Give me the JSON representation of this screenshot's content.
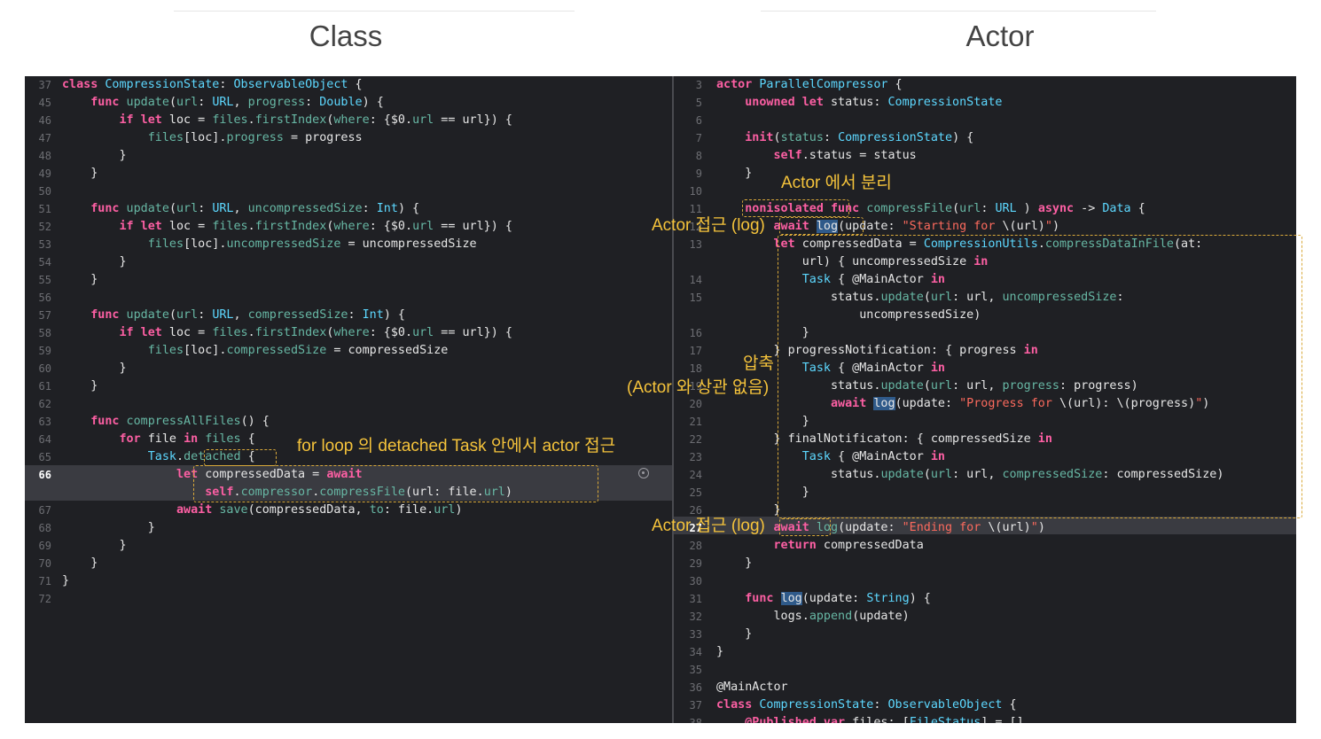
{
  "headings": {
    "left": "Class",
    "right": "Actor"
  },
  "left_lines": [
    {
      "n": "37",
      "t": [
        [
          "k",
          "class"
        ],
        [
          "",
          ""
        ],
        [
          "t",
          " CompressionState"
        ],
        [
          "",
          ": "
        ],
        [
          "t",
          "ObservableObject"
        ],
        [
          "",
          ""
        ],
        [
          "",
          " {"
        ]
      ]
    },
    {
      "n": "45",
      "t": [
        [
          "",
          "    "
        ],
        [
          "k",
          "func"
        ],
        [
          "f",
          " update"
        ],
        [
          "",
          "("
        ],
        [
          "f",
          "url"
        ],
        [
          "",
          ": "
        ],
        [
          "t",
          "URL"
        ],
        [
          "",
          ", "
        ],
        [
          "f",
          "progress"
        ],
        [
          "",
          ": "
        ],
        [
          "t",
          "Double"
        ],
        [
          "",
          ") {"
        ]
      ]
    },
    {
      "n": "46",
      "t": [
        [
          "",
          "        "
        ],
        [
          "k",
          "if let"
        ],
        [
          "",
          " loc = "
        ],
        [
          "f",
          "files"
        ],
        [
          "",
          "."
        ],
        [
          "f",
          "firstIndex"
        ],
        [
          "",
          "("
        ],
        [
          "f",
          "where"
        ],
        [
          "",
          ": {$0."
        ],
        [
          "f",
          "url"
        ],
        [
          "",
          " == url}) {"
        ]
      ]
    },
    {
      "n": "47",
      "t": [
        [
          "",
          "            "
        ],
        [
          "f",
          "files"
        ],
        [
          "",
          "[loc]."
        ],
        [
          "f",
          "progress"
        ],
        [
          "",
          " = progress"
        ]
      ]
    },
    {
      "n": "48",
      "t": [
        [
          "",
          "        }"
        ]
      ]
    },
    {
      "n": "49",
      "t": [
        [
          "",
          "    }"
        ]
      ]
    },
    {
      "n": "50",
      "t": [
        [
          "",
          ""
        ]
      ]
    },
    {
      "n": "51",
      "t": [
        [
          "",
          "    "
        ],
        [
          "k",
          "func"
        ],
        [
          "f",
          " update"
        ],
        [
          "",
          "("
        ],
        [
          "f",
          "url"
        ],
        [
          "",
          ": "
        ],
        [
          "t",
          "URL"
        ],
        [
          "",
          ", "
        ],
        [
          "f",
          "uncompressedSize"
        ],
        [
          "",
          ": "
        ],
        [
          "t",
          "Int"
        ],
        [
          "",
          ") {"
        ]
      ]
    },
    {
      "n": "52",
      "t": [
        [
          "",
          "        "
        ],
        [
          "k",
          "if let"
        ],
        [
          "",
          " loc = "
        ],
        [
          "f",
          "files"
        ],
        [
          "",
          "."
        ],
        [
          "f",
          "firstIndex"
        ],
        [
          "",
          "("
        ],
        [
          "f",
          "where"
        ],
        [
          "",
          ": {$0."
        ],
        [
          "f",
          "url"
        ],
        [
          "",
          " == url}) {"
        ]
      ]
    },
    {
      "n": "53",
      "t": [
        [
          "",
          "            "
        ],
        [
          "f",
          "files"
        ],
        [
          "",
          "[loc]."
        ],
        [
          "f",
          "uncompressedSize"
        ],
        [
          "",
          " = uncompressedSize"
        ]
      ]
    },
    {
      "n": "54",
      "t": [
        [
          "",
          "        }"
        ]
      ]
    },
    {
      "n": "55",
      "t": [
        [
          "",
          "    }"
        ]
      ]
    },
    {
      "n": "56",
      "t": [
        [
          "",
          ""
        ]
      ]
    },
    {
      "n": "57",
      "t": [
        [
          "",
          "    "
        ],
        [
          "k",
          "func"
        ],
        [
          "f",
          " update"
        ],
        [
          "",
          "("
        ],
        [
          "f",
          "url"
        ],
        [
          "",
          ": "
        ],
        [
          "t",
          "URL"
        ],
        [
          "",
          ", "
        ],
        [
          "f",
          "compressedSize"
        ],
        [
          "",
          ": "
        ],
        [
          "t",
          "Int"
        ],
        [
          "",
          ") {"
        ]
      ]
    },
    {
      "n": "58",
      "t": [
        [
          "",
          "        "
        ],
        [
          "k",
          "if let"
        ],
        [
          "",
          " loc = "
        ],
        [
          "f",
          "files"
        ],
        [
          "",
          "."
        ],
        [
          "f",
          "firstIndex"
        ],
        [
          "",
          "("
        ],
        [
          "f",
          "where"
        ],
        [
          "",
          ": {$0."
        ],
        [
          "f",
          "url"
        ],
        [
          "",
          " == url}) {"
        ]
      ]
    },
    {
      "n": "59",
      "t": [
        [
          "",
          "            "
        ],
        [
          "f",
          "files"
        ],
        [
          "",
          "[loc]."
        ],
        [
          "f",
          "compressedSize"
        ],
        [
          "",
          " = compressedSize"
        ]
      ]
    },
    {
      "n": "60",
      "t": [
        [
          "",
          "        }"
        ]
      ]
    },
    {
      "n": "61",
      "t": [
        [
          "",
          "    }"
        ]
      ]
    },
    {
      "n": "62",
      "t": [
        [
          "",
          ""
        ]
      ]
    },
    {
      "n": "63",
      "t": [
        [
          "",
          "    "
        ],
        [
          "k",
          "func"
        ],
        [
          "f",
          " compressAllFiles"
        ],
        [
          "",
          "() {"
        ]
      ]
    },
    {
      "n": "64",
      "t": [
        [
          "",
          "        "
        ],
        [
          "k",
          "for"
        ],
        [
          "",
          " file "
        ],
        [
          "k",
          "in"
        ],
        [
          "f",
          " files"
        ],
        [
          "",
          " {"
        ]
      ]
    },
    {
      "n": "65",
      "t": [
        [
          "",
          "            "
        ],
        [
          "t",
          "Task"
        ],
        [
          "",
          "."
        ],
        [
          "f",
          "detached"
        ],
        [
          "",
          " {"
        ]
      ]
    },
    {
      "n": "66",
      "t": [
        [
          "",
          "                "
        ],
        [
          "k",
          "let"
        ],
        [
          "",
          " compressedData = "
        ],
        [
          "k",
          "await"
        ]
      ]
    },
    {
      "n": "",
      "t": [
        [
          "",
          "                    "
        ],
        [
          "k",
          "self"
        ],
        [
          "",
          "."
        ],
        [
          "f",
          "compressor"
        ],
        [
          "",
          "."
        ],
        [
          "f",
          "compressFile"
        ],
        [
          "",
          "(url: file."
        ],
        [
          "f",
          "url"
        ],
        [
          "",
          ")"
        ]
      ]
    },
    {
      "n": "67",
      "t": [
        [
          "",
          "                "
        ],
        [
          "k",
          "await"
        ],
        [
          "f",
          " save"
        ],
        [
          "",
          "(compressedData, "
        ],
        [
          "f",
          "to"
        ],
        [
          "",
          ": file."
        ],
        [
          "f",
          "url"
        ],
        [
          "",
          ")"
        ]
      ]
    },
    {
      "n": "68",
      "t": [
        [
          "",
          "            }"
        ]
      ]
    },
    {
      "n": "69",
      "t": [
        [
          "",
          "        }"
        ]
      ]
    },
    {
      "n": "70",
      "t": [
        [
          "",
          "    }"
        ]
      ]
    },
    {
      "n": "71",
      "t": [
        [
          "",
          "}"
        ]
      ]
    },
    {
      "n": "72",
      "t": [
        [
          "",
          ""
        ]
      ]
    }
  ],
  "right_lines": [
    {
      "n": "3",
      "t": [
        [
          "k",
          "actor"
        ],
        [
          "t",
          " ParallelCompressor"
        ],
        [
          "",
          " {"
        ]
      ]
    },
    {
      "n": "5",
      "t": [
        [
          "",
          "    "
        ],
        [
          "k",
          "unowned let"
        ],
        [
          "",
          " status: "
        ],
        [
          "t",
          "CompressionState"
        ]
      ]
    },
    {
      "n": "6",
      "t": [
        [
          "",
          ""
        ]
      ]
    },
    {
      "n": "7",
      "t": [
        [
          "",
          "    "
        ],
        [
          "k",
          "init"
        ],
        [
          "",
          "("
        ],
        [
          "f",
          "status"
        ],
        [
          "",
          ": "
        ],
        [
          "t",
          "CompressionState"
        ],
        [
          "",
          ") {"
        ]
      ]
    },
    {
      "n": "8",
      "t": [
        [
          "",
          "        "
        ],
        [
          "k",
          "self"
        ],
        [
          "",
          ".status = status"
        ]
      ]
    },
    {
      "n": "9",
      "t": [
        [
          "",
          "    }"
        ]
      ]
    },
    {
      "n": "10",
      "t": [
        [
          "",
          ""
        ]
      ]
    },
    {
      "n": "11",
      "t": [
        [
          "",
          "    "
        ],
        [
          "k",
          "nonisolated"
        ],
        [
          "",
          " "
        ],
        [
          "k",
          "func"
        ],
        [
          "f",
          " compressFile"
        ],
        [
          "",
          "("
        ],
        [
          "f",
          "url"
        ],
        [
          "",
          ": "
        ],
        [
          "t",
          "URL"
        ],
        [
          "",
          " ) "
        ],
        [
          "k",
          "async"
        ],
        [
          "",
          " -> "
        ],
        [
          "t",
          "Data"
        ],
        [
          "",
          " {"
        ]
      ]
    },
    {
      "n": "12",
      "t": [
        [
          "",
          "        "
        ],
        [
          "k",
          "await"
        ],
        [
          "",
          " "
        ],
        [
          "sel",
          "log"
        ],
        [
          "",
          "(update: "
        ],
        [
          "s",
          "\"Starting for "
        ],
        [
          "",
          "\\(url)"
        ],
        [
          "s",
          "\""
        ],
        [
          "",
          ")"
        ]
      ]
    },
    {
      "n": "13",
      "t": [
        [
          "",
          "        "
        ],
        [
          "k",
          "let"
        ],
        [
          "",
          " compressedData = "
        ],
        [
          "t",
          "CompressionUtils"
        ],
        [
          "",
          "."
        ],
        [
          "f",
          "compressDataInFile"
        ],
        [
          "",
          "(at:"
        ]
      ]
    },
    {
      "n": "",
      "t": [
        [
          "",
          "            url) { uncompressedSize "
        ],
        [
          "k",
          "in"
        ]
      ]
    },
    {
      "n": "14",
      "t": [
        [
          "",
          "            "
        ],
        [
          "t",
          "Task"
        ],
        [
          "",
          " { @MainActor "
        ],
        [
          "k",
          "in"
        ]
      ]
    },
    {
      "n": "15",
      "t": [
        [
          "",
          "                status."
        ],
        [
          "f",
          "update"
        ],
        [
          "",
          "("
        ],
        [
          "f",
          "url"
        ],
        [
          "",
          ": url, "
        ],
        [
          "f",
          "uncompressedSize"
        ],
        [
          "",
          ":"
        ]
      ]
    },
    {
      "n": "",
      "t": [
        [
          "",
          "                    uncompressedSize)"
        ]
      ]
    },
    {
      "n": "16",
      "t": [
        [
          "",
          "            }"
        ]
      ]
    },
    {
      "n": "17",
      "t": [
        [
          "",
          "        } progressNotification: { progress "
        ],
        [
          "k",
          "in"
        ]
      ]
    },
    {
      "n": "18",
      "t": [
        [
          "",
          "            "
        ],
        [
          "t",
          "Task"
        ],
        [
          "",
          " { @MainActor "
        ],
        [
          "k",
          "in"
        ]
      ]
    },
    {
      "n": "19",
      "t": [
        [
          "",
          "                status."
        ],
        [
          "f",
          "update"
        ],
        [
          "",
          "("
        ],
        [
          "f",
          "url"
        ],
        [
          "",
          ": url, "
        ],
        [
          "f",
          "progress"
        ],
        [
          "",
          ": progress)"
        ]
      ]
    },
    {
      "n": "20",
      "t": [
        [
          "",
          "                "
        ],
        [
          "k",
          "await"
        ],
        [
          "",
          " "
        ],
        [
          "sel",
          "log"
        ],
        [
          "",
          "(update: "
        ],
        [
          "s",
          "\"Progress for "
        ],
        [
          "",
          "\\(url): \\(progress)"
        ],
        [
          "s",
          "\""
        ],
        [
          "",
          ")"
        ]
      ]
    },
    {
      "n": "21",
      "t": [
        [
          "",
          "            }"
        ]
      ]
    },
    {
      "n": "22",
      "t": [
        [
          "",
          "        } finalNotificaton: { compressedSize "
        ],
        [
          "k",
          "in"
        ]
      ]
    },
    {
      "n": "23",
      "t": [
        [
          "",
          "            "
        ],
        [
          "t",
          "Task"
        ],
        [
          "",
          " { @MainActor "
        ],
        [
          "k",
          "in"
        ]
      ]
    },
    {
      "n": "24",
      "t": [
        [
          "",
          "                status."
        ],
        [
          "f",
          "update"
        ],
        [
          "",
          "("
        ],
        [
          "f",
          "url"
        ],
        [
          "",
          ": url, "
        ],
        [
          "f",
          "compressedSize"
        ],
        [
          "",
          ": compressedSize)"
        ]
      ]
    },
    {
      "n": "25",
      "t": [
        [
          "",
          "            }"
        ]
      ]
    },
    {
      "n": "26",
      "t": [
        [
          "",
          "        }"
        ]
      ]
    },
    {
      "n": "27",
      "t": [
        [
          "",
          "        "
        ],
        [
          "k",
          "await"
        ],
        [
          "",
          " "
        ],
        [
          "f",
          "log"
        ],
        [
          "",
          "(update: "
        ],
        [
          "s",
          "\"Ending for "
        ],
        [
          "",
          "\\(url)"
        ],
        [
          "s",
          "\""
        ],
        [
          "",
          ")"
        ]
      ]
    },
    {
      "n": "28",
      "t": [
        [
          "",
          "        "
        ],
        [
          "k",
          "return"
        ],
        [
          "",
          " compressedData"
        ]
      ]
    },
    {
      "n": "29",
      "t": [
        [
          "",
          "    }"
        ]
      ]
    },
    {
      "n": "30",
      "t": [
        [
          "",
          ""
        ]
      ]
    },
    {
      "n": "31",
      "t": [
        [
          "",
          "    "
        ],
        [
          "k",
          "func"
        ],
        [
          "",
          " "
        ],
        [
          "sel",
          "log"
        ],
        [
          "",
          "(update: "
        ],
        [
          "t",
          "String"
        ],
        [
          "",
          ") {"
        ]
      ]
    },
    {
      "n": "32",
      "t": [
        [
          "",
          "        logs."
        ],
        [
          "f",
          "append"
        ],
        [
          "",
          "(update)"
        ]
      ]
    },
    {
      "n": "33",
      "t": [
        [
          "",
          "    }"
        ]
      ]
    },
    {
      "n": "34",
      "t": [
        [
          "",
          "}"
        ]
      ]
    },
    {
      "n": "35",
      "t": [
        [
          "",
          ""
        ]
      ]
    },
    {
      "n": "36",
      "t": [
        [
          "",
          "@MainActor"
        ]
      ]
    },
    {
      "n": "37",
      "t": [
        [
          "k",
          "class"
        ],
        [
          "t",
          " CompressionState"
        ],
        [
          "",
          ": "
        ],
        [
          "t",
          "ObservableObject"
        ],
        [
          "",
          " {"
        ]
      ]
    },
    {
      "n": "38",
      "t": [
        [
          "",
          "    "
        ],
        [
          "k",
          "@Published var"
        ],
        [
          "",
          " files: ["
        ],
        [
          "t",
          "FileStatus"
        ],
        [
          "",
          "] = []"
        ]
      ]
    }
  ],
  "annotations": {
    "detached_access": "for loop 의 detached Task 안에서 actor 접근",
    "actor_separate": "Actor 에서 분리",
    "actor_access_log_1": "Actor 접근 (log)",
    "compress": "압축",
    "actor_unrelated": "(Actor 와 상관 없음)",
    "actor_access_log_2": "Actor 접근 (log)"
  },
  "colors": {
    "background": "#1f2024",
    "keyword": "#fc5fa3",
    "type": "#5dd8ff",
    "function": "#67b7a4",
    "string": "#fc6a5d",
    "annotation": "#f5c33b"
  }
}
